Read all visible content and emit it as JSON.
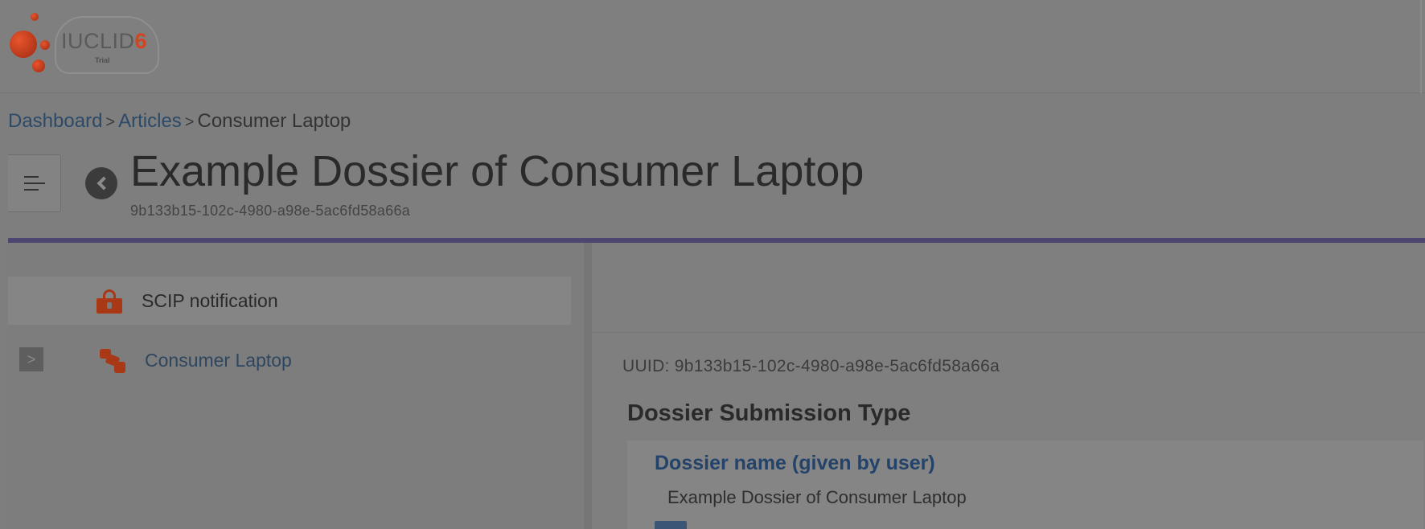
{
  "app": {
    "brand": "IUCLID",
    "brand_version": "6",
    "edition": "Trial"
  },
  "breadcrumb": {
    "items": [
      "Dashboard",
      "Articles",
      "Consumer Laptop"
    ],
    "separator": ">"
  },
  "header": {
    "title": "Example Dossier of Consumer Laptop",
    "uuid": "9b133b15-102c-4980-a98e-5ac6fd58a66a"
  },
  "tree": {
    "items": [
      {
        "label": "SCIP notification",
        "icon": "lock-icon",
        "selected": true
      },
      {
        "label": "Consumer Laptop",
        "icon": "laptop-icon",
        "expand": ">"
      }
    ]
  },
  "content": {
    "uuid_line": "UUID: 9b133b15-102c-4980-a98e-5ac6fd58a66a",
    "section_title": "Dossier Submission Type",
    "fields": [
      {
        "label": "Dossier name (given by user)",
        "value": "Example Dossier of Consumer Laptop"
      }
    ]
  },
  "colors": {
    "accent_line": "#4c4670",
    "icon_orange": "#a93817",
    "link_blue": "#24436a"
  }
}
